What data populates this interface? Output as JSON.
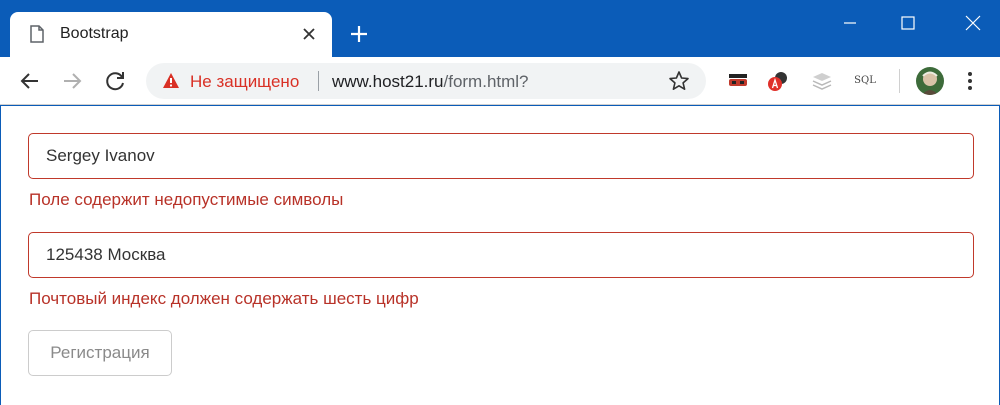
{
  "browser": {
    "tab": {
      "title": "Bootstrap"
    },
    "address_bar": {
      "security_label": "Не защищено",
      "url_host": "www.host21.ru",
      "url_path": "/form.html?"
    },
    "extensions": {
      "sql_label": "SQL"
    },
    "icons": [
      "page-icon",
      "close-icon",
      "plus-icon",
      "minimize-icon",
      "maximize-icon",
      "close-window-icon",
      "back-arrow-icon",
      "forward-arrow-icon",
      "reload-icon",
      "warning-icon",
      "star-icon",
      "mask-icon",
      "translate-icon",
      "layers-icon",
      "user-avatar",
      "kebab-menu-icon"
    ],
    "colors": {
      "titlebar": "#0b5cb8",
      "warning": "#d93025",
      "error": "#b83228"
    }
  },
  "form": {
    "name_field": {
      "value": "Sergey Ivanov",
      "error": "Поле содержит недопустимые символы"
    },
    "address_field": {
      "value": "125438 Москва",
      "error": "Почтовый индекс должен содержать шесть цифр"
    },
    "submit_label": "Регистрация"
  }
}
